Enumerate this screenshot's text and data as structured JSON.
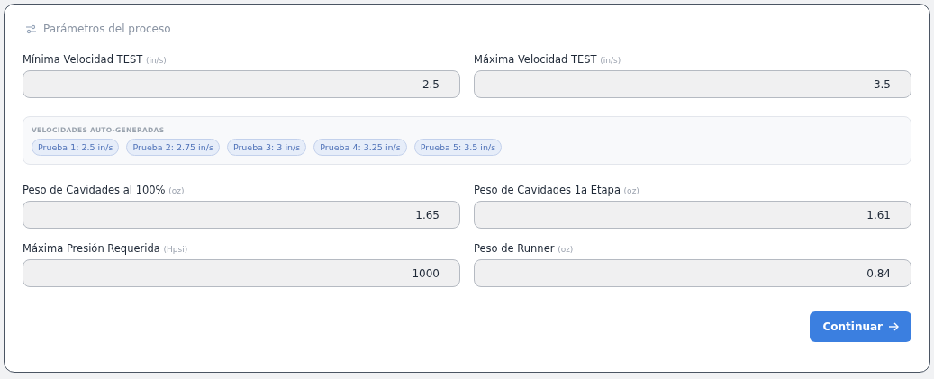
{
  "section": {
    "title": "Parámetros del proceso"
  },
  "top_fields": [
    {
      "label": "Mínima Velocidad TEST",
      "unit": "(in/s)",
      "value": "2.5"
    },
    {
      "label": "Máxima Velocidad TEST",
      "unit": "(in/s)",
      "value": "3.5"
    }
  ],
  "auto_speeds": {
    "title": "VELOCIDADES AUTO-GENERADAS",
    "chips": [
      "Prueba 1: 2.5 in/s",
      "Prueba 2: 2.75 in/s",
      "Prueba 3: 3 in/s",
      "Prueba 4: 3.25 in/s",
      "Prueba 5: 3.5 in/s"
    ]
  },
  "bottom_fields": [
    {
      "label": "Peso de Cavidades al 100%",
      "unit": "(oz)",
      "value": "1.65"
    },
    {
      "label": "Peso de Cavidades 1a Etapa",
      "unit": "(oz)",
      "value": "1.61"
    },
    {
      "label": "Máxima Presión Requerida",
      "unit": "(Hpsi)",
      "value": "1000"
    },
    {
      "label": "Peso de Runner",
      "unit": "(oz)",
      "value": "0.84"
    }
  ],
  "button": {
    "label": "Continuar"
  }
}
